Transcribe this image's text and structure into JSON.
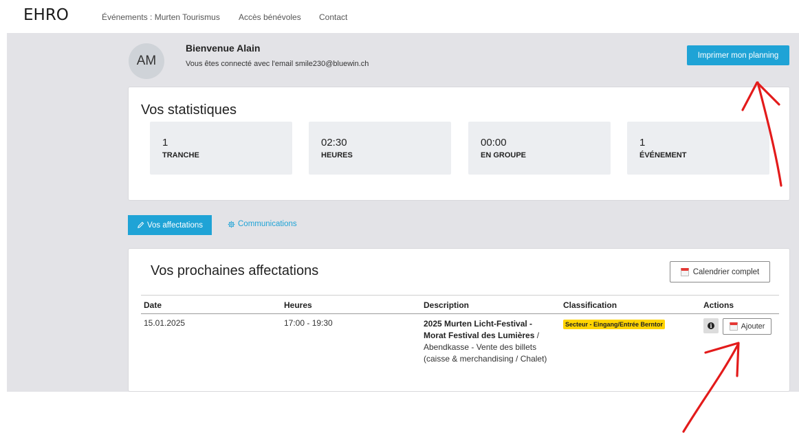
{
  "nav": {
    "logo": "EHRO",
    "links": [
      "Événements : Murten Tourismus",
      "Accès bénévoles",
      "Contact"
    ]
  },
  "user": {
    "initials": "AM",
    "welcome": "Bienvenue Alain",
    "email_line": "Vous êtes connecté avec l'email smile230@bluewin.ch"
  },
  "print_button": "Imprimer mon planning",
  "stats": {
    "title": "Vos statistiques",
    "items": [
      {
        "value": "1",
        "label": "TRANCHE"
      },
      {
        "value": "02:30",
        "label": "HEURES"
      },
      {
        "value": "00:00",
        "label": "EN GROUPE"
      },
      {
        "value": "1",
        "label": "ÉVÉNEMENT"
      }
    ]
  },
  "tabs": {
    "active": "Vos affectations",
    "inactive": "Communications"
  },
  "assignments": {
    "title": "Vos prochaines affectations",
    "calendar_button": "Calendrier complet",
    "columns": [
      "Date",
      "Heures",
      "Description",
      "Classification",
      "Actions"
    ],
    "rows": [
      {
        "date": "15.01.2025",
        "hours": "17:00 - 19:30",
        "description_bold": "2025 Murten Licht-Festival - Morat Festival des Lumières",
        "description_sep": " / ",
        "description_rest": "Abendkasse - Vente des billets (caisse & merchandising / Chalet)",
        "classification": "Secteur - Eingang/Entrée Berntor",
        "add_button": "Ajouter"
      }
    ]
  },
  "colors": {
    "accent": "#1fa3d6",
    "badge": "#ffd400",
    "annotation": "#e31b1b",
    "backdrop": "#e3e3e7"
  }
}
